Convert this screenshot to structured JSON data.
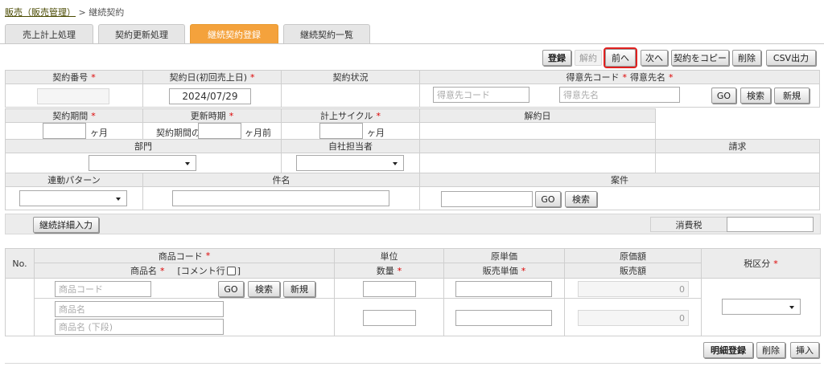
{
  "breadcrumb": {
    "parent": "販売（販売管理）",
    "separator": ">",
    "current": "継続契約"
  },
  "tabs": [
    {
      "label": "売上計上処理"
    },
    {
      "label": "契約更新処理"
    },
    {
      "label": "継続契約登録"
    },
    {
      "label": "継続契約一覧"
    }
  ],
  "toolbar": {
    "register": "登録",
    "cancel": "解約",
    "prev": "前へ",
    "next": "次へ",
    "copy": "契約をコピー",
    "delete": "削除",
    "csv": "CSV出力"
  },
  "form": {
    "contract_no_label": "契約番号",
    "contract_date_label": "契約日(初回売上日)",
    "contract_date_value": "2024/07/29",
    "contract_status_label": "契約状況",
    "customer_label_code": "得意先コード",
    "customer_label_name": "得意先名",
    "customer_code_placeholder": "得意先コード",
    "customer_name_placeholder": "得意先名",
    "go": "GO",
    "search": "検索",
    "new": "新規",
    "period_label": "契約期間",
    "months_unit": "ヶ月",
    "renewal_label": "更新時期",
    "renewal_prefix": "契約期間の",
    "renewal_suffix": "ヶ月前",
    "cycle_label": "計上サイクル",
    "cancel_date_label": "解約日",
    "dept_label": "部門",
    "staff_label": "自社担当者",
    "billing_label": "請求",
    "link_pattern_label": "連動パターン",
    "subject_label": "件名",
    "project_label": "案件",
    "required_mark": "*"
  },
  "detail_input_button": "継続詳細入力",
  "tax_label": "消費税",
  "detail_table": {
    "no_header": "No.",
    "product_code_header": "商品コード",
    "product_name_header": "商品名",
    "comment_line_label": "[コメント行",
    "comment_line_close": "]",
    "unit_header": "単位",
    "qty_header": "数量",
    "cost_unit_header": "原単価",
    "sale_unit_header": "販売単価",
    "cost_amount_header": "原価額",
    "sale_amount_header": "販売額",
    "tax_class_header": "税区分",
    "product_code_placeholder": "商品コード",
    "product_name_placeholder": "商品名",
    "product_name_lower_placeholder": "商品名 (下段)",
    "cost_amount_value": "0",
    "sale_amount_value": "0"
  },
  "bottom_buttons": {
    "detail_register": "明細登録",
    "delete": "削除",
    "insert": "挿入"
  }
}
